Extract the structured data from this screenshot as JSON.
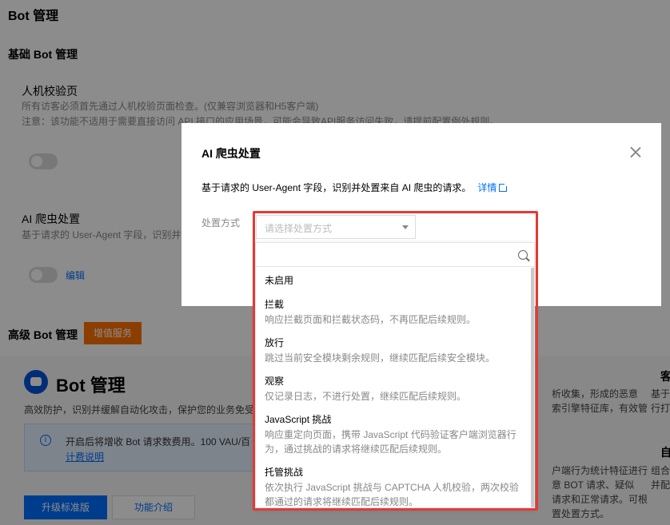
{
  "background": {
    "page_title": "Bot 管理",
    "basic_section_title": "基础 Bot 管理",
    "captcha_title": "人机校验页",
    "captcha_desc_1": "所有访客必须首先通过人机校验页面检查。(仅兼容浏览器和H5客户端)",
    "captcha_desc_2": "注意：该功能不适用于需要直接访问 API 接口的应用场景，可能会导致API服务访问失败，请提前配置例外规则。",
    "ai_title": "AI 爬虫处置",
    "ai_desc": "基于请求的 User-Agent 字段，识别并",
    "edit_label": "编辑",
    "advanced_section_title": "高级 Bot 管理",
    "vas_badge": "增值服务",
    "bot_card_title": "Bot 管理",
    "bot_card_desc": "高效防护，识别并缓解自动化攻击，保护您的业务免受",
    "notice_text": "开启后将增收 Bot 请求数费用。100 VAU/百",
    "notice_link": "计费说明",
    "upgrade_button": "升级标准版",
    "intro_button": "功能介绍",
    "right_col_1": "析收集，形成的恶意",
    "right_col_2": "索引擎特征库，有效管",
    "right_col_3": "户端行为统计特征进行",
    "right_col_4": "意 BOT 请求、疑似",
    "right_col_5": "请求和正常请求。可根",
    "right_col_6": "置处置方式。",
    "right_head_1": "客",
    "right_sub_1": "基于",
    "right_sub_2": "行打",
    "right_head_2": "自",
    "right_sub_3": "组合",
    "right_sub_4": "并配"
  },
  "modal": {
    "title": "AI 爬虫处置",
    "description": "基于请求的 User-Agent 字段，识别并处置来自 AI 爬虫的请求。",
    "detail_link": "详情",
    "form_label": "处置方式",
    "select_placeholder": "请选择处置方式",
    "search_placeholder": ""
  },
  "dropdown": {
    "options": [
      {
        "title": "未启用",
        "desc": ""
      },
      {
        "title": "拦截",
        "desc": "响应拦截页面和拦截状态码，不再匹配后续规则。"
      },
      {
        "title": "放行",
        "desc": "跳过当前安全模块剩余规则，继续匹配后续安全模块。"
      },
      {
        "title": "观察",
        "desc": "仅记录日志，不进行处置，继续匹配后续规则。"
      },
      {
        "title": "JavaScript 挑战",
        "desc": "响应重定向页面，携带 JavaScript 代码验证客户端浏览器行为，通过挑战的请求将继续匹配后续规则。"
      },
      {
        "title": "托管挑战",
        "desc": "依次执行 JavaScript 挑战与 CAPTCHA 人机校验，两次校验都通过的请求将继续匹配后续规则。"
      }
    ]
  },
  "colors": {
    "accent": "#006eff",
    "badge": "#ff7200",
    "highlight": "#e53935"
  }
}
